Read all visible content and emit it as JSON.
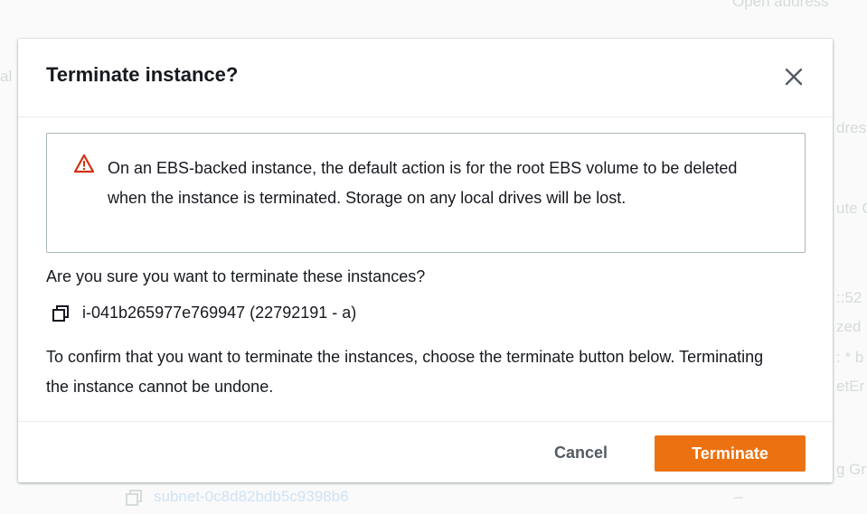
{
  "background": {
    "top_right_text": "Open address",
    "left_fragment": "al",
    "right_fragments": [
      "dres",
      "ute C",
      "::52",
      "zed",
      ": * b",
      "etEr",
      "g Gr"
    ],
    "subnet_link": "subnet-0c8d82bdb5c9398b6",
    "dash": "–"
  },
  "modal": {
    "title": "Terminate instance?",
    "close_icon": "close-icon",
    "alert": {
      "icon": "warning-triangle-icon",
      "color": "#d13212",
      "text": "On an EBS-backed instance, the default action is for the root EBS volume to be deleted when the instance is terminated. Storage on any local drives will be lost."
    },
    "question": "Are you sure you want to terminate these instances?",
    "instance": {
      "icon": "copy-icon",
      "label": "i-041b265977e769947 (22792191 - a)"
    },
    "confirm_text": "To confirm that you want to terminate the instances, choose the terminate button below. Terminating the instance cannot be undone.",
    "footer": {
      "cancel_label": "Cancel",
      "terminate_label": "Terminate",
      "terminate_color": "#ec7211"
    }
  }
}
